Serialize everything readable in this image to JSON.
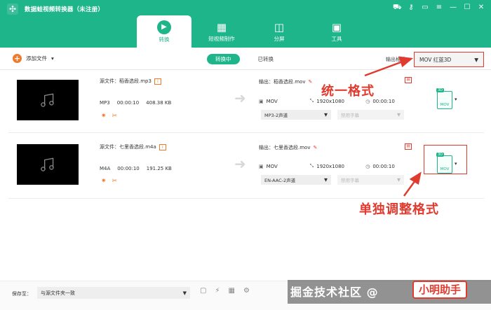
{
  "app": {
    "title": "数据蛙视频转换器（未注册）",
    "logo_icon": "frog-logo-icon",
    "window_controls": [
      "cart-icon",
      "key-icon",
      "feedback-icon",
      "menu-icon",
      "minimize-icon",
      "maximize-icon",
      "close-icon"
    ]
  },
  "tabs": [
    {
      "label": "转换",
      "icon": "convert-icon",
      "active": true
    },
    {
      "label": "短视频制作",
      "icon": "short-video-icon",
      "active": false
    },
    {
      "label": "分屏",
      "icon": "split-screen-icon",
      "active": false
    },
    {
      "label": "工具",
      "icon": "toolbox-icon",
      "active": false
    }
  ],
  "toolbar": {
    "add_file": "添加文件",
    "converting": "转换中",
    "converted": "已转换",
    "output_format_label": "输出格式",
    "output_format_value": "MOV 红蓝3D"
  },
  "files": [
    {
      "source_label": "源文件：稻香选段.mp3",
      "format": "MP3",
      "duration": "00:00:10",
      "size": "408.38 KB",
      "output_label": "输出：稻香选段.mov",
      "out_format": "MOV",
      "resolution": "1920x1080",
      "out_duration": "00:00:10",
      "audio_track": "MP3-2声道",
      "subtitle": "禁用字幕",
      "format_badge": "3D",
      "format_icon_text": "MOV"
    },
    {
      "source_label": "源文件：七里香选段.m4a",
      "format": "M4A",
      "duration": "00:00:10",
      "size": "191.25 KB",
      "output_label": "输出：七里香选段.mov",
      "out_format": "MOV",
      "resolution": "1920x1080",
      "out_duration": "00:00:10",
      "audio_track": "EN-AAC-2声道",
      "subtitle": "禁用字幕",
      "format_badge": "3D",
      "format_icon_text": "MOV"
    }
  ],
  "annotations": {
    "unified": "统一格式",
    "individual": "单独调整格式"
  },
  "bottom": {
    "save_to_label": "保存至：",
    "save_to_value": "与源文件夹一致"
  },
  "watermark": {
    "text": "掘金技术社区 @",
    "author": "小明助手"
  },
  "colors": {
    "brand": "#1fb58b",
    "accent": "#f07a2c",
    "annotation": "#e03b2f"
  }
}
